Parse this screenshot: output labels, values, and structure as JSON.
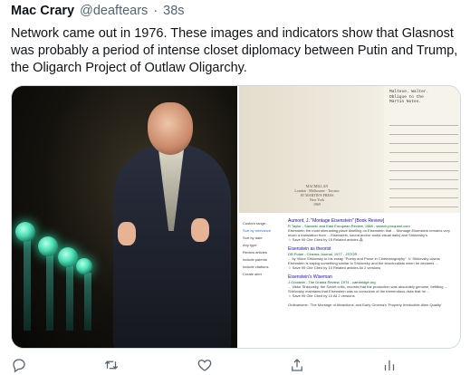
{
  "tweet": {
    "author_name": "Mac Crary",
    "author_handle": "@deaftears",
    "separator": "·",
    "timestamp": "38s",
    "text": "Network came out in 1976.  These images and indicators show that Glasnost was probably a period of intense closet diplomacy between Putin and Trump, the Oligarch Project of Outlaw Oligarchy."
  },
  "media": {
    "doc": {
      "lines": [
        "Maltese. Walter.",
        "Oblique to the",
        "Martin Notes."
      ],
      "publisher": [
        "MACMILLAN",
        "London · Melbourne · Toronto",
        "ST MARTIN'S PRESS",
        "New York",
        "1969"
      ]
    },
    "search": {
      "sidebar": [
        "Custom range...",
        "Sort by relevance",
        "Sort by date",
        "Any type",
        "Review articles",
        "include patents",
        "include citations",
        "Create alert"
      ],
      "results": [
        {
          "title": "Aumont, J. \"Montage Eisenstein\" [Book Review]",
          "meta": "R Taylor - Slavonic and East European Review, 1988 - search.proquest.com",
          "snippet": "Eisenstein the most stimulating place dwelling on Eisenstein that ... Montage Eisenstein remains very much a translation from ... Eisenstein, sound and/or audio-visual italic) and Shklovsky's",
          "links": "☆ Save  99 Cite  Cited by 15  Related articles  ⁂"
        },
        {
          "title": "Eisenstein as theorist",
          "meta": "DR Polan - Cinema Journal, 1977 - JSTOR",
          "snippet": "... by Viktor Shklovsky in his essay \"Poetry and Prose in Cinematography\". V. Shklovsky claims Eisenstein is saying something similar to Shklovsky and the structuralists when he declares ...",
          "links": "☆ Save  99 Cite  Cited by 10  Related articles  All 2 versions"
        },
        {
          "title": "Eisenstein's Wiseman",
          "meta": "J Goodwin - The Drama Review, 1974 - cambridge.org",
          "snippet": "... Viktor Shklovsky, the Soviet critic, records that the production was absolutely genuine, befitting ... Shklovsky maintains that Eisenstein was so conscious of the tremendous risks that he ...",
          "links": "☆ Save  99 Cite  Cited by 10  All 2 versions"
        },
        {
          "title": "Ordinarisme: 'The Montage of Attractions' and Early Cinema's 'Properly Irreducible Alien Quality'",
          "meta": "",
          "snippet": "",
          "links": ""
        }
      ]
    }
  },
  "actions": {
    "reply_icon": "reply-icon",
    "retweet_icon": "retweet-icon",
    "like_icon": "like-icon",
    "share_icon": "share-icon",
    "analytics_icon": "analytics-icon"
  }
}
